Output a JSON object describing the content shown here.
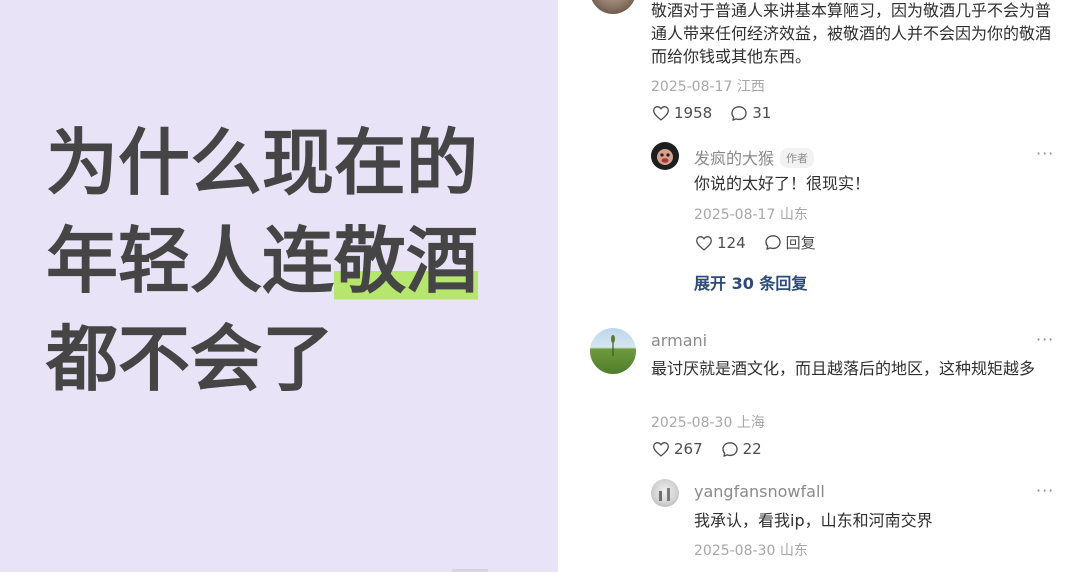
{
  "cover": {
    "title_line1": "为什么现在的",
    "title_line2_plain": "年轻人连",
    "title_line2_highlight": "敬酒",
    "title_line3": "都不会了",
    "highlight_color": "#b6e66e",
    "background_color": "#e8e3f6"
  },
  "comments": {
    "c1": {
      "text": "敬酒对于普通人来讲基本算陋习，因为敬酒几乎不会为普通人带来任何经济效益，被敬酒的人并不会因为你的敬酒而给你钱或其他东西。",
      "date": "2025-08-17",
      "location": "江西",
      "likes": "1958",
      "replies": "31",
      "reply": {
        "user": "发疯的大猴",
        "tag": "作者",
        "text": "你说的太好了！很现实！",
        "date": "2025-08-17",
        "location": "山东",
        "likes": "124",
        "reply_label": "回复"
      },
      "expand_label": "展开 30 条回复"
    },
    "c2": {
      "user": "armani",
      "text": "最讨厌就是酒文化，而且越落后的地区，这种规矩越多",
      "date": "2025-08-30",
      "location": "上海",
      "likes": "267",
      "replies": "22",
      "reply": {
        "user": "yangfansnowfall",
        "text": "我承认，看我ip，山东和河南交界",
        "date": "2025-08-30",
        "location": "山东"
      }
    },
    "more_label": "···"
  }
}
